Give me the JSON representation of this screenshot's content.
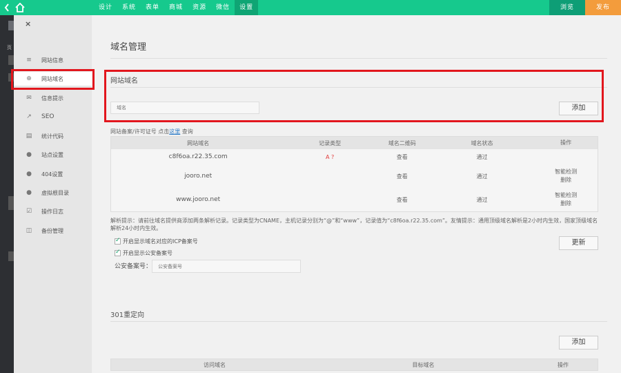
{
  "topbar": {
    "back_icon": "chevron-left-icon",
    "home_icon": "home-icon",
    "nav": [
      "设计",
      "系统",
      "表单",
      "商城",
      "资源",
      "微信",
      "设置"
    ],
    "active_nav": "设置",
    "preview_label": "浏览",
    "publish_label": "发布",
    "colors": {
      "bar": "#16c98d",
      "active": "#0fa574",
      "preview": "#0e9e76",
      "publish": "#f39c3c"
    }
  },
  "darkstrip": {
    "label": "页"
  },
  "sidebar": {
    "close_icon": "×",
    "items": [
      {
        "label": "网站信息",
        "icon": "≡"
      },
      {
        "label": "网站域名",
        "icon": "⊕"
      },
      {
        "label": "信息提示",
        "icon": "✉"
      },
      {
        "label": "SEO",
        "icon": "↗"
      },
      {
        "label": "统计代码",
        "icon": "▤"
      },
      {
        "label": "站点设置",
        "icon": "●"
      },
      {
        "label": "404设置",
        "icon": "●"
      },
      {
        "label": "虚拟根目录",
        "icon": "●"
      },
      {
        "label": "操作日志",
        "icon": "☑"
      },
      {
        "label": "备份管理",
        "icon": "◫"
      }
    ],
    "active": "网站域名"
  },
  "main": {
    "page_title": "域名管理",
    "domain_section": {
      "title": "网站域名",
      "input_placeholder": "域名",
      "add_label": "添加"
    },
    "filing_note": {
      "prefix": "网站备案/许可证号 点击",
      "link": "这里",
      "suffix": " 查询"
    },
    "table": {
      "headers": [
        "网站域名",
        "记录类型",
        "域名二维码",
        "域名状态",
        "操作"
      ],
      "rows": [
        {
          "domain": "c8f6oa.r22.35.com",
          "type": "A ?",
          "qr": "查看",
          "status": "通过",
          "actions": []
        },
        {
          "domain": "jooro.net",
          "type": "",
          "qr": "查看",
          "status": "通过",
          "actions": [
            "智能检测",
            "删除"
          ]
        },
        {
          "domain": "www.jooro.net",
          "type": "",
          "qr": "查看",
          "status": "通过",
          "actions": [
            "智能检测",
            "删除"
          ]
        }
      ]
    },
    "hint": "解析提示：请前往域名提供商添加两条解析记录。记录类型为CNAME，主机记录分别为“@”和“www”，记录值为“c8f6oa.r22.35.com”。友情提示：通用顶级域名解析是2小时内生效，国家顶级域名解析24小时内生效。",
    "checks": [
      "开启显示域名对应的ICP备案号",
      "开启显示公安备案号"
    ],
    "police": {
      "label": "公安备案号：",
      "placeholder": "公安备案号"
    },
    "update_label": "更新",
    "redirect": {
      "title": "301重定向",
      "add_label": "添加",
      "headers": [
        "访问域名",
        "目标域名",
        "操作"
      ]
    }
  }
}
